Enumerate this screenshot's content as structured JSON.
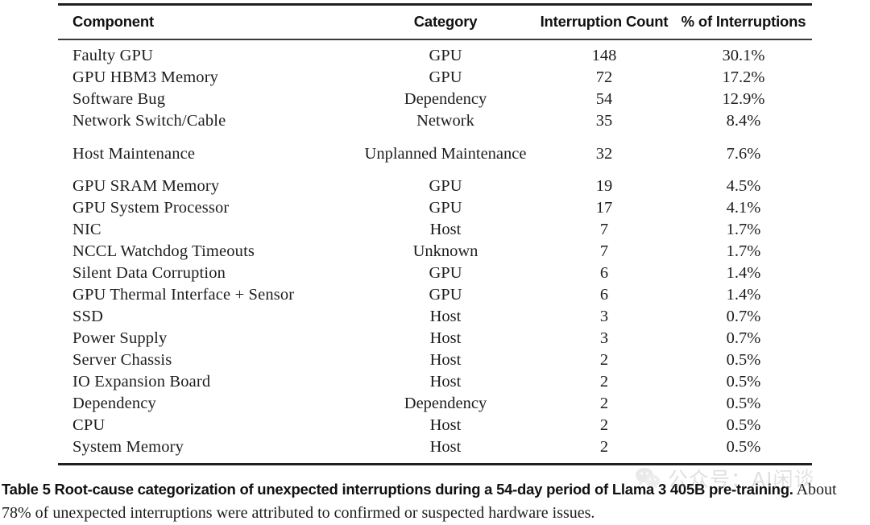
{
  "table": {
    "columns": [
      {
        "key": "component",
        "label": "Component",
        "align": "left"
      },
      {
        "key": "category",
        "label": "Category",
        "align": "center"
      },
      {
        "key": "count",
        "label": "Interruption Count",
        "align": "center"
      },
      {
        "key": "pct",
        "label": "% of Interruptions",
        "align": "center"
      }
    ],
    "rows": [
      {
        "component": "Faulty GPU",
        "category": "GPU",
        "count": "148",
        "pct": "30.1%"
      },
      {
        "component": "GPU HBM3 Memory",
        "category": "GPU",
        "count": "72",
        "pct": "17.2%"
      },
      {
        "component": "Software Bug",
        "category": "Dependency",
        "count": "54",
        "pct": "12.9%"
      },
      {
        "component": "Network Switch/Cable",
        "category": "Network",
        "count": "35",
        "pct": "8.4%"
      },
      {
        "component": "Host Maintenance",
        "category": "Unplanned Maintenance",
        "count": "32",
        "pct": "7.6%",
        "two_line": true
      },
      {
        "component": "GPU SRAM Memory",
        "category": "GPU",
        "count": "19",
        "pct": "4.5%"
      },
      {
        "component": "GPU System Processor",
        "category": "GPU",
        "count": "17",
        "pct": "4.1%"
      },
      {
        "component": "NIC",
        "category": "Host",
        "count": "7",
        "pct": "1.7%"
      },
      {
        "component": "NCCL Watchdog Timeouts",
        "category": "Unknown",
        "count": "7",
        "pct": "1.7%"
      },
      {
        "component": "Silent Data Corruption",
        "category": "GPU",
        "count": "6",
        "pct": "1.4%"
      },
      {
        "component": "GPU Thermal Interface + Sensor",
        "category": "GPU",
        "count": "6",
        "pct": "1.4%"
      },
      {
        "component": "SSD",
        "category": "Host",
        "count": "3",
        "pct": "0.7%"
      },
      {
        "component": "Power Supply",
        "category": "Host",
        "count": "3",
        "pct": "0.7%"
      },
      {
        "component": "Server Chassis",
        "category": "Host",
        "count": "2",
        "pct": "0.5%"
      },
      {
        "component": "IO Expansion Board",
        "category": "Host",
        "count": "2",
        "pct": "0.5%"
      },
      {
        "component": "Dependency",
        "category": "Dependency",
        "count": "2",
        "pct": "0.5%"
      },
      {
        "component": "CPU",
        "category": "Host",
        "count": "2",
        "pct": "0.5%"
      },
      {
        "component": "System Memory",
        "category": "Host",
        "count": "2",
        "pct": "0.5%"
      }
    ]
  },
  "caption": {
    "bold": "Table 5  Root-cause categorization of unexpected interruptions during a 54-day period of Llama 3 405B pre-training.",
    "rest": " About 78% of unexpected interruptions were attributed to confirmed or suspected hardware issues."
  },
  "watermark": {
    "text": "公众号：AI闲谈",
    "color": "#9a9a9a"
  },
  "colors": {
    "rule": "#231f20",
    "rule_mid": "#3a3a3a",
    "text": "#1d1d1d",
    "background": "#ffffff"
  }
}
